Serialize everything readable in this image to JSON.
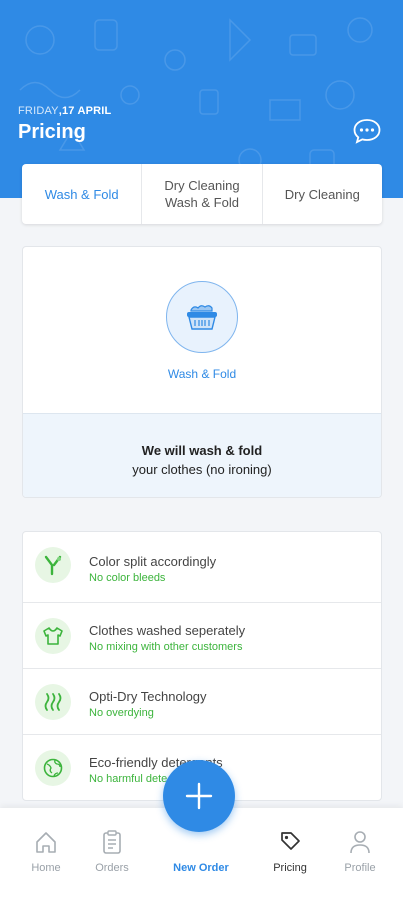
{
  "header": {
    "date_day": "FRIDAY",
    "date_rest": ",17 APRIL",
    "title": "Pricing",
    "chat_icon": "chat-bubble-icon"
  },
  "tabs": [
    {
      "label": "Wash & Fold",
      "active": true
    },
    {
      "label": "Dry Cleaning\nWash & Fold",
      "active": false
    },
    {
      "label": "Dry Cleaning",
      "active": false
    }
  ],
  "service": {
    "icon": "laundry-basket-icon",
    "label": "Wash & Fold",
    "desc_strong": "We will wash & fold",
    "desc_rest": "your clothes (no ironing)"
  },
  "features": [
    {
      "icon": "color-split-icon",
      "title": "Color split accordingly",
      "subtitle": "No color bleeds"
    },
    {
      "icon": "shirt-icon",
      "title": "Clothes washed seperately",
      "subtitle": "No mixing with other customers"
    },
    {
      "icon": "heat-waves-icon",
      "title": "Opti-Dry Technology",
      "subtitle": "No overdying"
    },
    {
      "icon": "globe-icon",
      "title": "Eco-friendly detergents",
      "subtitle": "No harmful dete"
    }
  ],
  "nav": [
    {
      "icon": "home-icon",
      "label": "Home"
    },
    {
      "icon": "clipboard-icon",
      "label": "Orders"
    },
    {
      "icon": "plus-icon",
      "label": "New Order"
    },
    {
      "icon": "tag-icon",
      "label": "Pricing"
    },
    {
      "icon": "user-icon",
      "label": "Profile"
    }
  ],
  "colors": {
    "primary": "#2f8ae5",
    "accent_green": "#3cb43c"
  }
}
